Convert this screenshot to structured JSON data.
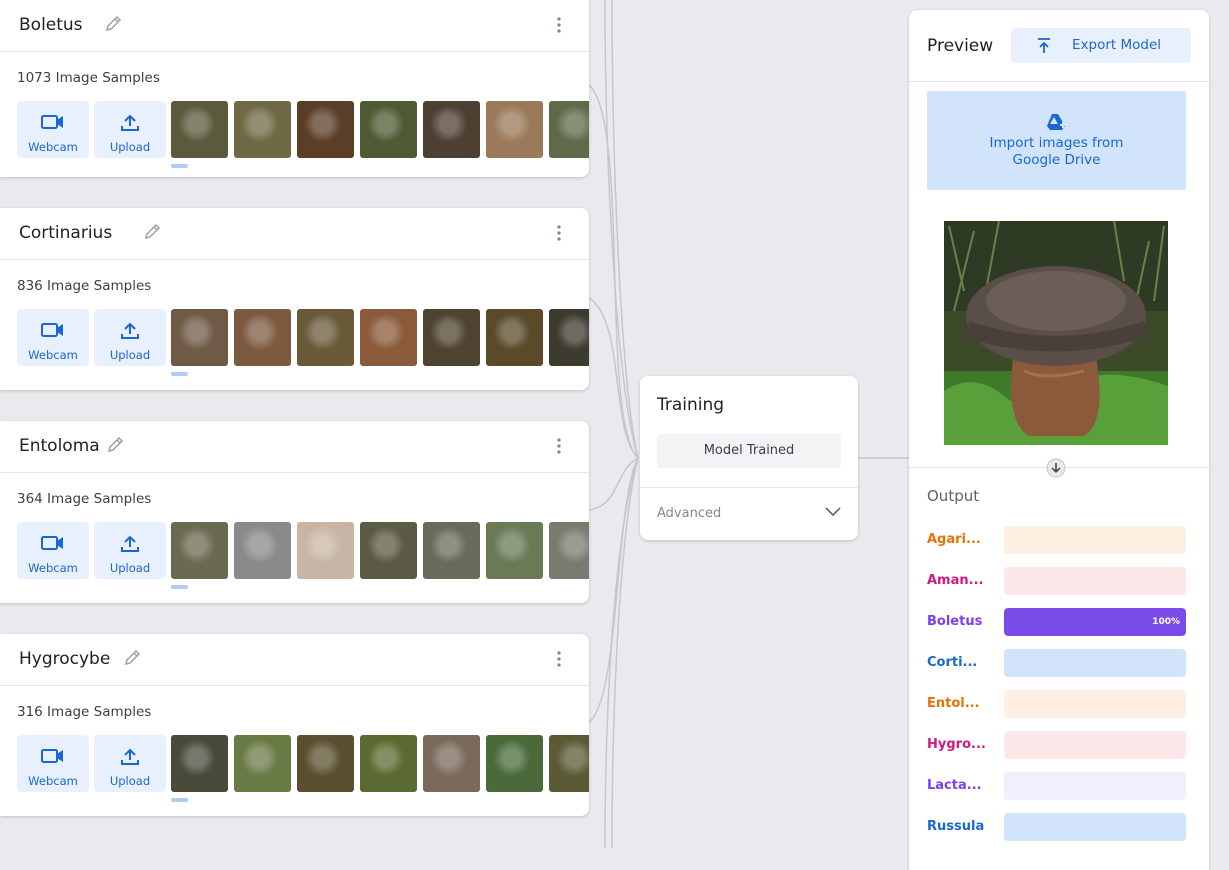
{
  "classes": [
    {
      "name": "Boletus",
      "samples": "1073 Image Samples",
      "webcam_label": "Webcam",
      "upload_label": "Upload",
      "thumb_colors": [
        "#5b5a3c",
        "#6f6a45",
        "#5a3e28",
        "#4d5a33",
        "#4e3f33",
        "#9a7a5a",
        "#5f6a4a"
      ]
    },
    {
      "name": "Cortinarius",
      "samples": "836 Image Samples",
      "webcam_label": "Webcam",
      "upload_label": "Upload",
      "thumb_colors": [
        "#6e5a45",
        "#7c5a40",
        "#6a5a3a",
        "#8a5a3a",
        "#4e4330",
        "#5a4a2a",
        "#3d3a2f"
      ]
    },
    {
      "name": "Entoloma",
      "samples": "364 Image Samples",
      "webcam_label": "Webcam",
      "upload_label": "Upload",
      "thumb_colors": [
        "#6a6a50",
        "#8a8a8a",
        "#c8b5a5",
        "#5a5a45",
        "#6a6a5a",
        "#6a7a55",
        "#7a7a70"
      ]
    },
    {
      "name": "Hygrocybe",
      "samples": "316 Image Samples",
      "webcam_label": "Webcam",
      "upload_label": "Upload",
      "thumb_colors": [
        "#4a4a3a",
        "#6a7a45",
        "#5a5030",
        "#5a6a30",
        "#7a6a5a",
        "#4a6a3a",
        "#5a5a35"
      ]
    }
  ],
  "training": {
    "title": "Training",
    "status_button": "Model Trained",
    "advanced_label": "Advanced"
  },
  "preview": {
    "title": "Preview",
    "export_label": "Export Model",
    "import_label_line1": "Import images from",
    "import_label_line2": "Google Drive",
    "output_title": "Output",
    "outputs": [
      {
        "label": "Agari...",
        "color": "#e8710a",
        "bg": "#feefe3",
        "value": 0
      },
      {
        "label": "Aman...",
        "color": "#d01884",
        "bg": "#fde7e9",
        "value": 0
      },
      {
        "label": "Boletus",
        "color": "#7b3ff0",
        "bg": "#ede7f6",
        "fill": "#7b4bea",
        "value": 1.0,
        "value_text": "100%"
      },
      {
        "label": "Corti...",
        "color": "#1967d2",
        "bg": "#d2e3fc",
        "value": 0
      },
      {
        "label": "Entol...",
        "color": "#e8710a",
        "bg": "#feefe3",
        "value": 0
      },
      {
        "label": "Hygro...",
        "color": "#d01884",
        "bg": "#fde7e9",
        "value": 0
      },
      {
        "label": "Lacta...",
        "color": "#7b3ff0",
        "bg": "#f0effd",
        "value": 0
      },
      {
        "label": "Russula",
        "color": "#1967d2",
        "bg": "#d2e3fc",
        "value": 0
      }
    ]
  }
}
